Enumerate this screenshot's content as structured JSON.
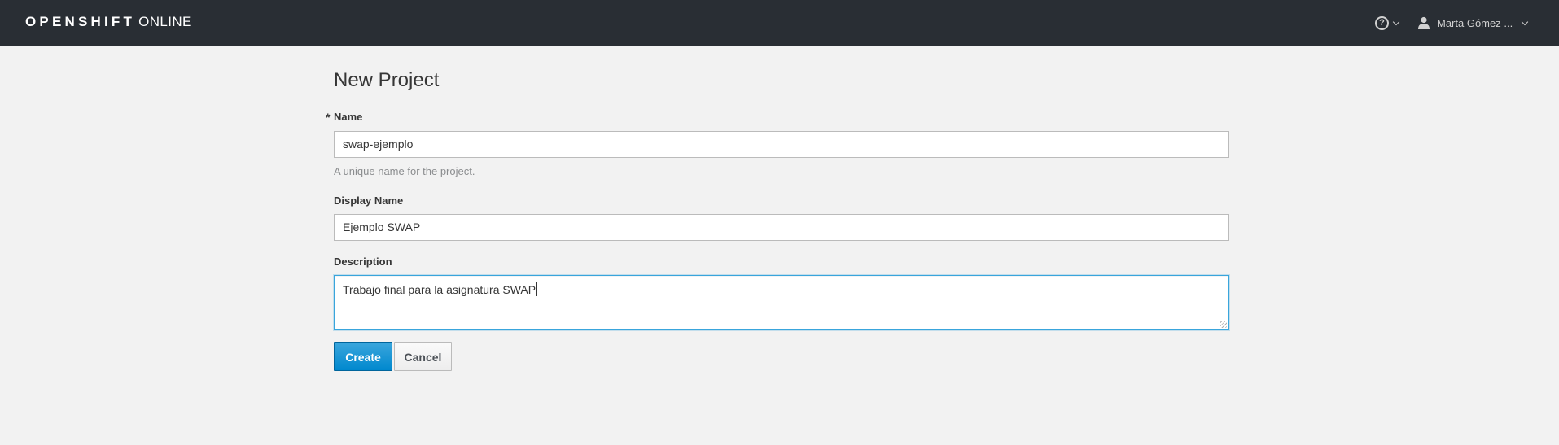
{
  "header": {
    "brand_strong": "OPENSHIFT",
    "brand_light": "ONLINE",
    "help_icon": "question-circle-icon",
    "help_glyph": "?",
    "user_icon": "user-icon",
    "user_name": "Marta Gómez ..."
  },
  "form": {
    "title": "New Project",
    "required_mark": "*",
    "name": {
      "label": "Name",
      "value": "swap-ejemplo",
      "help": "A unique name for the project."
    },
    "display_name": {
      "label": "Display Name",
      "value": "Ejemplo SWAP"
    },
    "description": {
      "label": "Description",
      "value": "Trabajo final para la asignatura SWAP"
    },
    "buttons": {
      "create": "Create",
      "cancel": "Cancel"
    }
  },
  "colors": {
    "navbar": "#292e34",
    "page_background": "#f2f2f2",
    "primary": "#0088ce",
    "focus_border": "#39a5dc"
  }
}
